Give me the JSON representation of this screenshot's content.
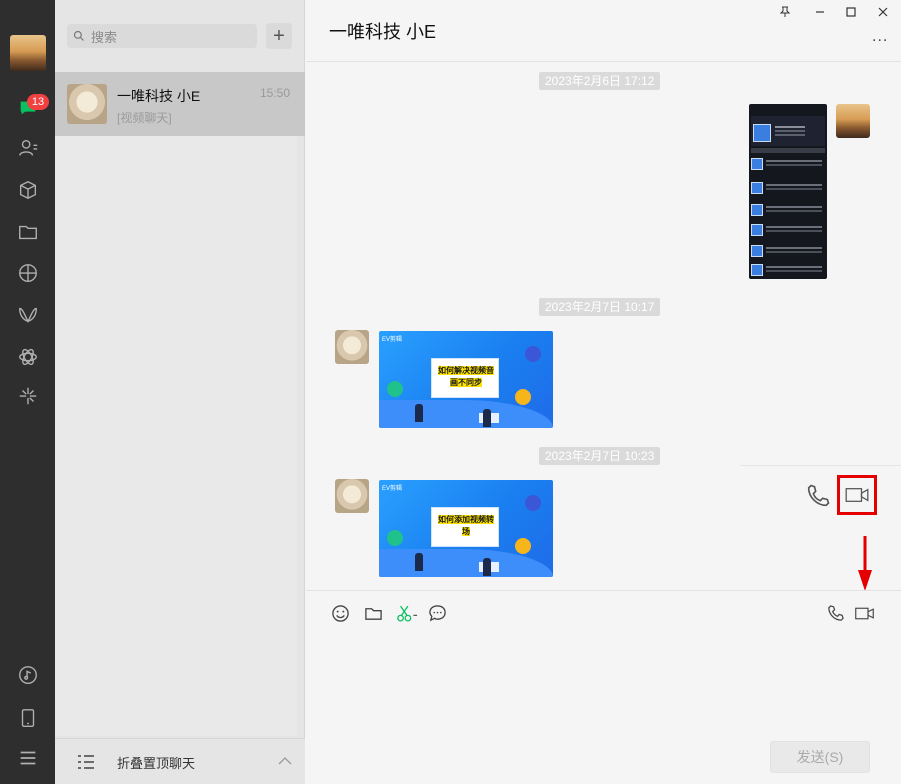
{
  "nav": {
    "unread_badge": "13",
    "icons": [
      "chat-icon",
      "contacts-icon",
      "favorites-icon",
      "files-icon",
      "moments-icon",
      "channels-icon",
      "search-apps-icon",
      "mini-programs-icon",
      "music-icon",
      "phone-icon",
      "menu-icon"
    ]
  },
  "sessions": {
    "search_placeholder": "搜索",
    "add_label": "+",
    "items": [
      {
        "name": "一唯科技 小E",
        "time": "15:50",
        "preview": "[视频聊天]"
      }
    ],
    "fold_label": "折叠置顶聊天"
  },
  "chat": {
    "title": "一唯科技 小E",
    "more_label": "...",
    "messages": [
      {
        "timestamp": "2023年2月6日 17:12",
        "from": "me",
        "type": "image"
      },
      {
        "timestamp": "2023年2月7日 10:17",
        "from": "them",
        "type": "image",
        "card_brand": "EV剪辑",
        "card_text": "如何解决视频音画不同步"
      },
      {
        "timestamp": "2023年2月7日 10:23",
        "from": "them",
        "type": "image",
        "card_brand": "EV剪辑",
        "card_text": "如何添加视频转场"
      }
    ],
    "send_label": "发送(S)"
  },
  "colors": {
    "nav_bg": "#2e2e2e",
    "list_bg": "#e6e5e5",
    "chat_bg": "#f5f5f5",
    "accent_green": "#07c160",
    "highlight_red": "#e40000",
    "badge_red": "#f04040"
  }
}
